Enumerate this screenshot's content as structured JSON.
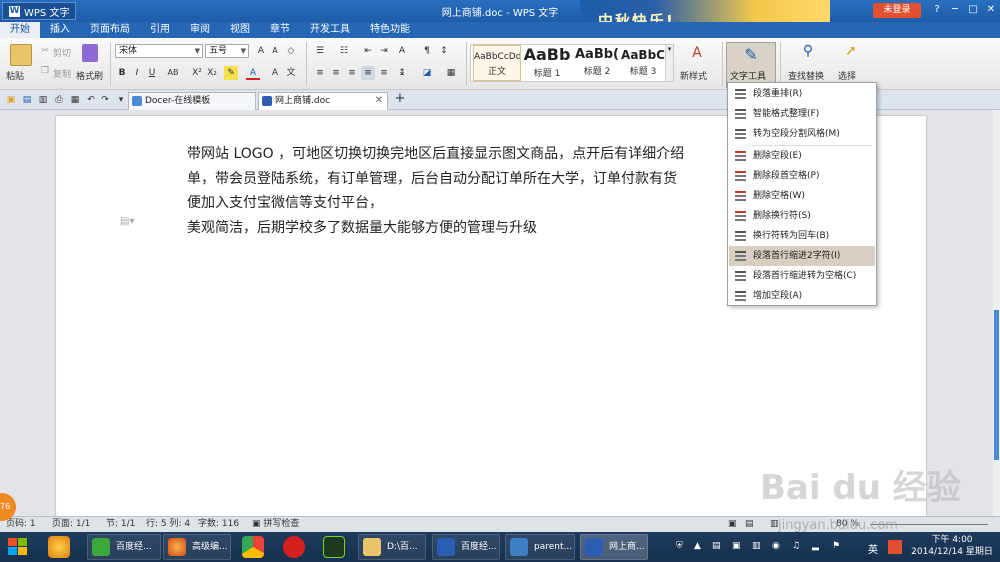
{
  "window": {
    "app_menu": "WPS 文字",
    "title": "网上商铺.doc - WPS 文字",
    "banner": "中秋快乐!",
    "login": "未登录",
    "controls": [
      "?",
      "─",
      "□",
      "✕"
    ]
  },
  "menu_tabs": [
    "开始",
    "插入",
    "页面布局",
    "引用",
    "审阅",
    "视图",
    "章节",
    "开发工具",
    "特色功能"
  ],
  "ribbon": {
    "paste": "粘贴",
    "cut": "剪切",
    "copy": "复制",
    "format_painter": "格式刷",
    "font_name": "宋体",
    "font_size": "五号",
    "styles": [
      {
        "sample": "AaBbCcDd",
        "name": "正文"
      },
      {
        "sample": "AaBb",
        "name": "标题 1"
      },
      {
        "sample": "AaBb(",
        "name": "标题 2"
      },
      {
        "sample": "AaBbC",
        "name": "标题 3"
      }
    ],
    "new_style": "新样式",
    "text_tools": "文字工具",
    "find_replace": "查找替换",
    "select": "选择"
  },
  "doc_tabs": [
    {
      "label": "Docer-在线模板",
      "active": false
    },
    {
      "label": "网上商铺.doc",
      "active": true
    }
  ],
  "document": {
    "lines": [
      "带网站 LOGO ，可地区切换切换完地区后直接显示图文商品，点开后有详细介绍",
      "单，带会员登陆系统，有订单管理，后台自动分配订单所在大学，订单付款有货",
      "便加入支付宝微信等支付平台，",
      "美观简洁，后期学校多了数据量大能够方便的管理与升级"
    ]
  },
  "text_tools_menu": {
    "items": [
      {
        "label": "段落重排(R)",
        "icon": "paragraph-reflow-icon"
      },
      {
        "label": "智能格式整理(F)",
        "icon": "smart-format-icon"
      },
      {
        "label": "转为空段分割风格(M)",
        "icon": "empty-para-split-icon"
      },
      {
        "label": "删除空段(E)",
        "icon": "delete-empty-para-icon"
      },
      {
        "label": "删除段首空格(P)",
        "icon": "delete-leading-space-icon"
      },
      {
        "label": "删除空格(W)",
        "icon": "delete-space-icon"
      },
      {
        "label": "删除换行符(S)",
        "icon": "delete-linebreak-icon"
      },
      {
        "label": "换行符转为回车(B)",
        "icon": "linebreak-to-enter-icon"
      },
      {
        "label": "段落首行缩进2字符(I)",
        "icon": "first-line-indent-icon"
      },
      {
        "label": "段落首行缩进转为空格(C)",
        "icon": "indent-to-space-icon"
      },
      {
        "label": "增加空段(A)",
        "icon": "add-empty-para-icon"
      }
    ],
    "highlighted_index": 8
  },
  "status_bar": {
    "page": "页码: 1",
    "pages": "页面: 1/1",
    "section": "节: 1/1",
    "row_col": "行: 5  列: 4",
    "word_count": "字数: 116",
    "spell_check": "拼写检查",
    "zoom": "80 %"
  },
  "taskbar": {
    "items": [
      {
        "label": "百度经..."
      },
      {
        "label": "高级编..."
      },
      {
        "label": "D:\\百..."
      },
      {
        "label": "百度经..."
      },
      {
        "label": "parent..."
      },
      {
        "label": "网上商..."
      }
    ],
    "input_method": "英",
    "time": "下午 4:00",
    "date": "2014/12/14 星期日"
  },
  "watermark": {
    "main": "Bai du 经验",
    "sub": "jingyan.baidu.com"
  },
  "side_badge": "76",
  "colors": {
    "title_bar": "#1d5ca8",
    "accent_orange": "#e2502f",
    "menu_highlight": "#d8cfc3",
    "scroll_thumb": "#4a8ad6"
  }
}
